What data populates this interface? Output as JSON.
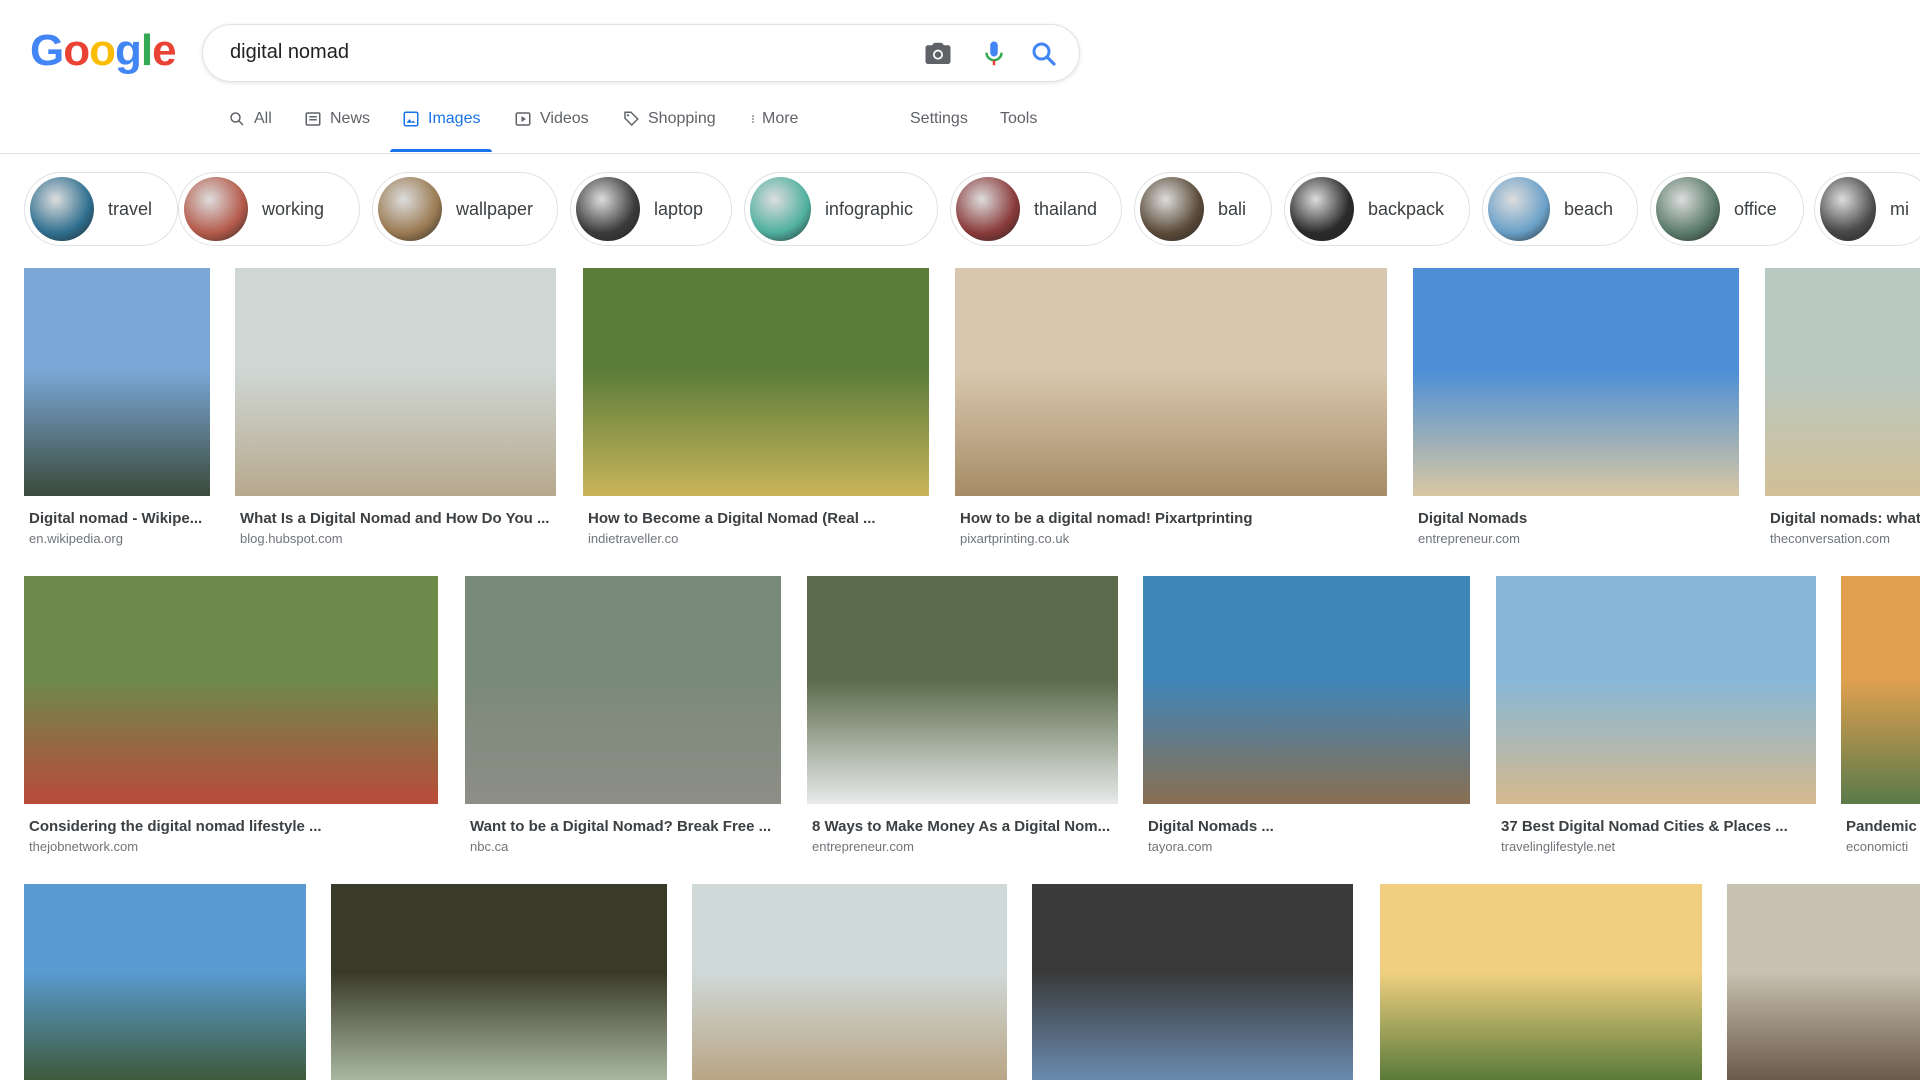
{
  "logo": {
    "letters": [
      "G",
      "o",
      "o",
      "g",
      "l",
      "e"
    ],
    "colors": [
      "#4285f4",
      "#ea4335",
      "#fbbc05",
      "#4285f4",
      "#34a853",
      "#ea4335"
    ]
  },
  "search": {
    "query": "digital nomad"
  },
  "tabs": [
    {
      "label": "All",
      "icon": "search-icon"
    },
    {
      "label": "News",
      "icon": "news-icon"
    },
    {
      "label": "Images",
      "icon": "images-icon",
      "active": true
    },
    {
      "label": "Videos",
      "icon": "videos-icon"
    },
    {
      "label": "Shopping",
      "icon": "shopping-icon"
    },
    {
      "label": "More",
      "icon": "more-vert-icon"
    }
  ],
  "tools": {
    "settings": "Settings",
    "tools": "Tools"
  },
  "chips": [
    {
      "label": "travel",
      "color": "#2f6f8f"
    },
    {
      "label": "working",
      "color": "#b45a4a"
    },
    {
      "label": "wallpaper",
      "color": "#9a7a52"
    },
    {
      "label": "laptop",
      "color": "#3a3a3a"
    },
    {
      "label": "infographic",
      "color": "#4fb0a0"
    },
    {
      "label": "thailand",
      "color": "#8a3a3a"
    },
    {
      "label": "bali",
      "color": "#5a4a38"
    },
    {
      "label": "backpack",
      "color": "#2a2a2a"
    },
    {
      "label": "beach",
      "color": "#6aa0c8"
    },
    {
      "label": "office",
      "color": "#5a7a6a"
    },
    {
      "label": "mi",
      "color": "#4a4a4a"
    }
  ],
  "rows": [
    [
      {
        "title": "Digital nomad - Wikipe...",
        "domain": "en.wikipedia.org",
        "c1": "#7aa7d6",
        "c2": "#3b4a3a"
      },
      {
        "title": "What Is a Digital Nomad and How Do You ...",
        "domain": "blog.hubspot.com",
        "c1": "#cfd7d4",
        "c2": "#b7a88d"
      },
      {
        "title": "How to Become a Digital Nomad (Real ...",
        "domain": "indietraveller.co",
        "c1": "#5b7d3a",
        "c2": "#c9b45a"
      },
      {
        "title": "How to be a digital nomad! Pixartprinting",
        "domain": "pixartprinting.co.uk",
        "c1": "#d8c7ae",
        "c2": "#a68c66"
      },
      {
        "title": "Digital Nomads",
        "domain": "entrepreneur.com",
        "c1": "#4d8fd6",
        "c2": "#d9c8a2"
      },
      {
        "title": "Digital nomads: what",
        "domain": "theconversation.com",
        "c1": "#b9c9c2",
        "c2": "#d2bf96"
      }
    ],
    [
      {
        "title": "Considering the digital nomad lifestyle ...",
        "domain": "thejobnetwork.com",
        "c1": "#6d8a4a",
        "c2": "#b94a3a"
      },
      {
        "title": "Want to be a Digital Nomad? Break Free ...",
        "domain": "nbc.ca",
        "c1": "#7a8a7a",
        "c2": "#8e8e86"
      },
      {
        "title": "8 Ways to Make Money As a Digital Nom...",
        "domain": "entrepreneur.com",
        "c1": "#5a6a4a",
        "c2": "#e8ebea"
      },
      {
        "title": "Digital Nomads ...",
        "domain": "tayora.com",
        "c1": "#3f86b8",
        "c2": "#8a6e52"
      },
      {
        "title": "37 Best Digital Nomad Cities & Places ...",
        "domain": "travelinglifestyle.net",
        "c1": "#86b7d8",
        "c2": "#d6b98e"
      },
      {
        "title": "Pandemic",
        "domain": "economicti",
        "c1": "#e0a050",
        "c2": "#5a7a4a"
      }
    ],
    [
      {
        "title": "",
        "domain": "",
        "c1": "#5a9ad0",
        "c2": "#3d5a3a"
      },
      {
        "title": "",
        "domain": "",
        "c1": "#3a3a2a",
        "c2": "#a8b8a0"
      },
      {
        "title": "",
        "domain": "",
        "c1": "#cfd9d8",
        "c2": "#b9a585"
      },
      {
        "title": "",
        "domain": "",
        "c1": "#3a3a3a",
        "c2": "#6a8ab0"
      },
      {
        "title": "",
        "domain": "",
        "c1": "#f0d080",
        "c2": "#5a7a3a"
      },
      {
        "title": "",
        "domain": "",
        "c1": "#c8c0b0",
        "c2": "#6a5a4a"
      }
    ]
  ]
}
